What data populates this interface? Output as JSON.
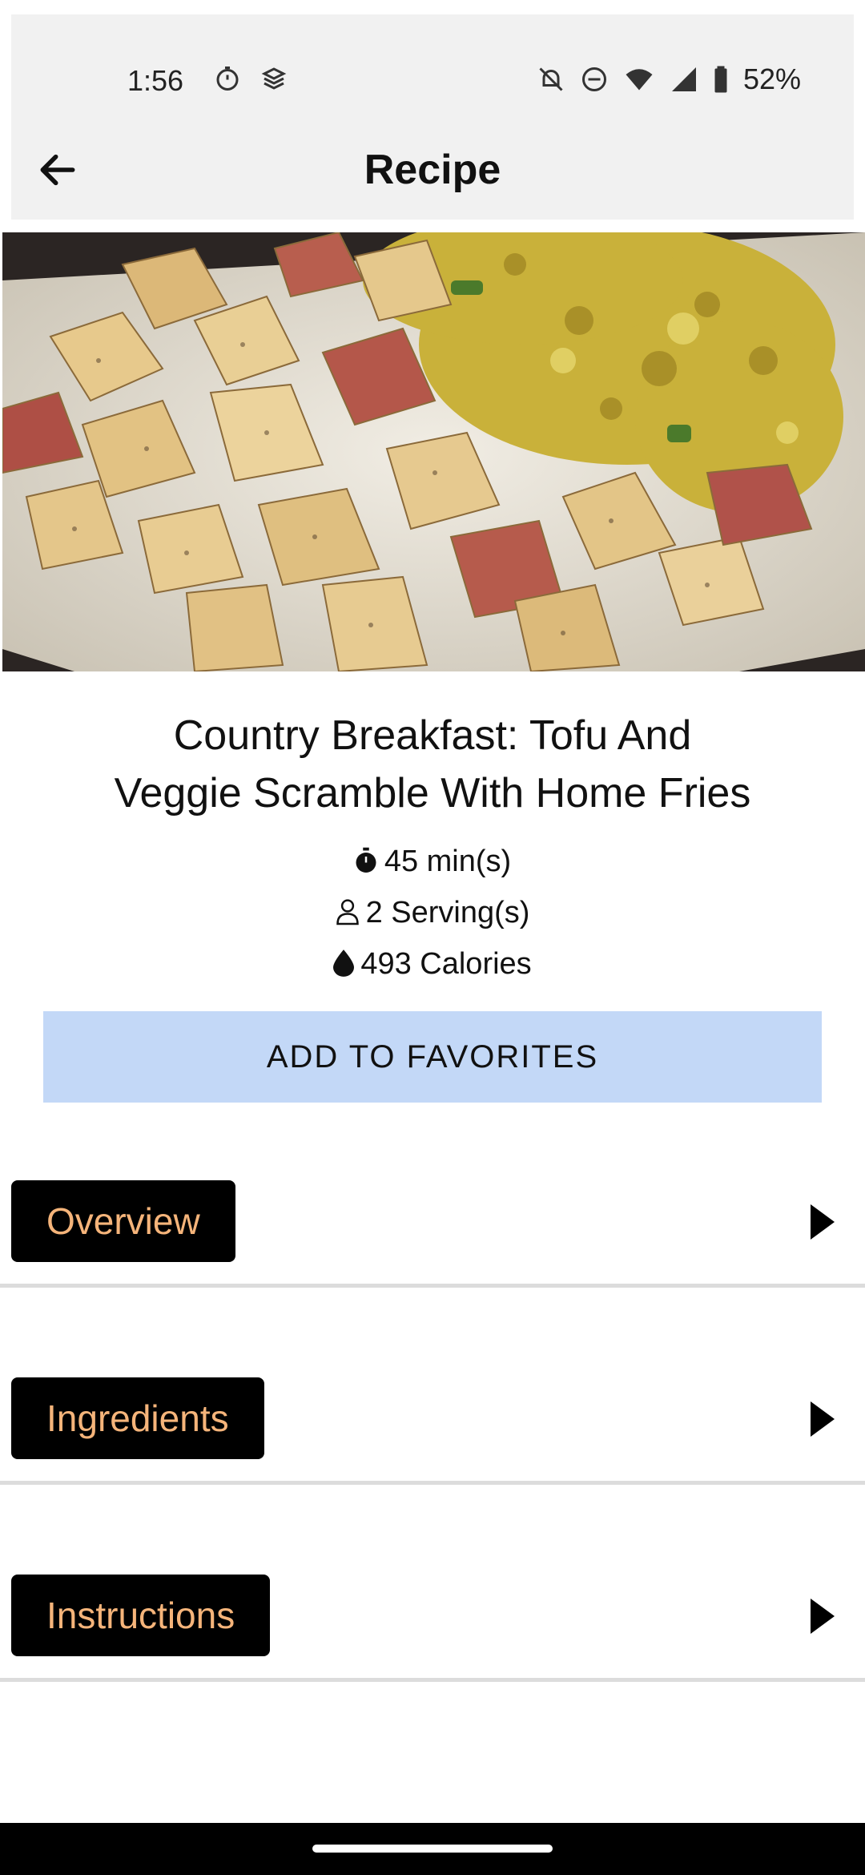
{
  "status_bar": {
    "time": "1:56",
    "battery": "52%"
  },
  "app_bar": {
    "title": "Recipe"
  },
  "recipe": {
    "title_line1": "Country Breakfast: Tofu And",
    "title_line2": "Veggie Scramble With Home Fries",
    "time": "45 min(s)",
    "servings": "2 Serving(s)",
    "calories": "493 Calories"
  },
  "favorites_button": "ADD TO FAVORITES",
  "sections": [
    {
      "label": "Overview"
    },
    {
      "label": "Ingredients"
    },
    {
      "label": "Instructions"
    }
  ],
  "colors": {
    "accent_button": "#c3d8f7",
    "section_label": "#f5b47a"
  }
}
